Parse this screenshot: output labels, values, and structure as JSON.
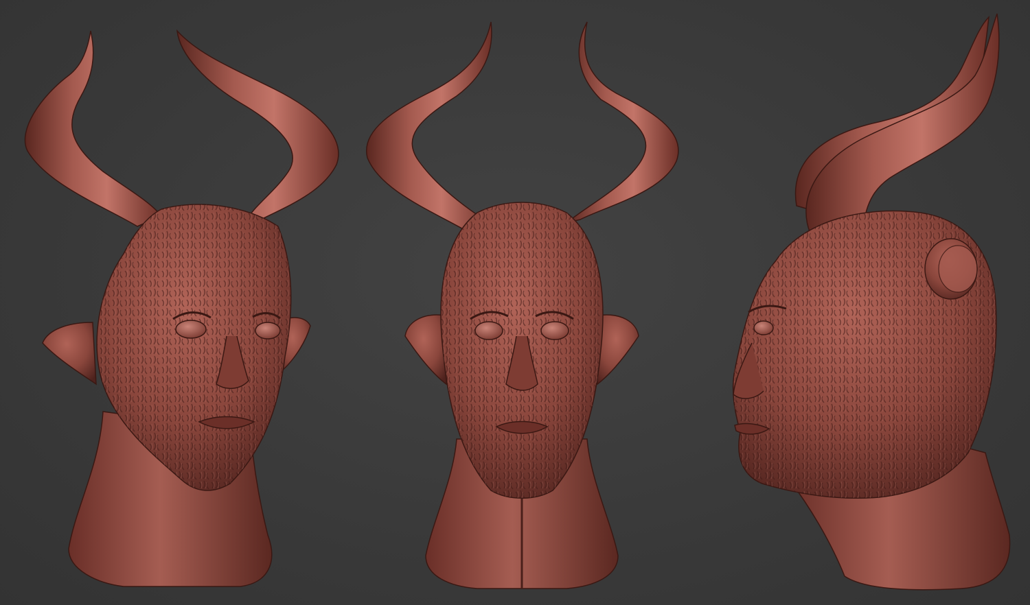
{
  "scene": {
    "description_kind": "sculpt-turnaround",
    "views": [
      {
        "id": "three-quarter",
        "kind": "three-quarter-view"
      },
      {
        "id": "front",
        "kind": "front-view"
      },
      {
        "id": "side",
        "kind": "side-view"
      }
    ],
    "colors": {
      "background": "#3b3b3b",
      "clay_light": "#b86a5e",
      "clay_mid": "#8f4a40",
      "clay_dark": "#4d211c",
      "clay_shadow": "#2e1411"
    }
  }
}
